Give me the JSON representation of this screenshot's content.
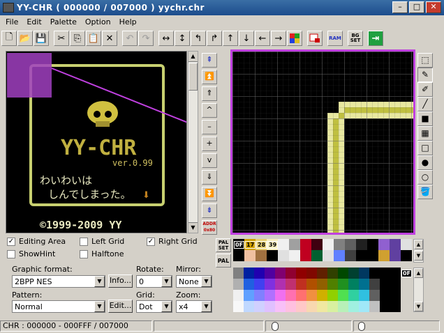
{
  "window": {
    "title": "YY-CHR ( 000000 / 007000 ) yychr.chr",
    "minimize": "–",
    "maximize": "□",
    "close": "✕"
  },
  "menu": [
    "File",
    "Edit",
    "Palette",
    "Option",
    "Help"
  ],
  "toolbar": {
    "buttons": [
      "new",
      "open",
      "save",
      "cut",
      "copy",
      "paste",
      "delete",
      "undo",
      "redo",
      "flip-horizontal",
      "flip-vertical",
      "rotate-left",
      "rotate-right",
      "shift-up",
      "shift-down",
      "shift-left",
      "shift-right",
      "palette-view",
      "tile-edit"
    ],
    "ram_label": "RAM",
    "bgset_label": "BG SET"
  },
  "chr_view": {
    "logo_text": "YY-CHR",
    "version": "ver.0.99",
    "line1": "わいわいは",
    "line2": "しんでしまった。",
    "copyright": "©1999-2009 YY"
  },
  "nav": {
    "buttons": [
      "⇞",
      "⏫",
      "⇑",
      "^",
      "–",
      "+",
      "v",
      "⇓",
      "⏬",
      "⇟"
    ],
    "addr_label": "ADDR 0x80"
  },
  "tools": [
    "select",
    "pen",
    "pen-fine",
    "line",
    "rect-fill",
    "pattern",
    "rect",
    "circle-fill",
    "circle",
    "fill"
  ],
  "options": {
    "editing_area": {
      "label": "Editing Area",
      "checked": true
    },
    "left_grid": {
      "label": "Left Grid",
      "checked": false
    },
    "right_grid": {
      "label": "Right Grid",
      "checked": true
    },
    "show_hint": {
      "label": "ShowHint",
      "checked": false
    },
    "halftone": {
      "label": "Halftone",
      "checked": false
    }
  },
  "format": {
    "graphic_format_label": "Graphic format:",
    "graphic_format_value": "2BPP NES",
    "info_button": "Info...",
    "rotate_label": "Rotate:",
    "rotate_value": "0",
    "mirror_label": "Mirror:",
    "mirror_value": "None",
    "pattern_label": "Pattern:",
    "pattern_value": "Normal",
    "edit_button": "Edit...",
    "grid_label": "Grid:",
    "grid_value": "Dot",
    "zoom_label": "Zoom:",
    "zoom_value": "x4"
  },
  "palette": {
    "pal_set_label": "PAL SET",
    "pal_label": "PAL",
    "selected_codes": [
      "0F",
      "17",
      "28",
      "39"
    ],
    "big_index": "0F"
  },
  "status": {
    "range": "CHR : 000000 - 000FFF / 007000"
  }
}
